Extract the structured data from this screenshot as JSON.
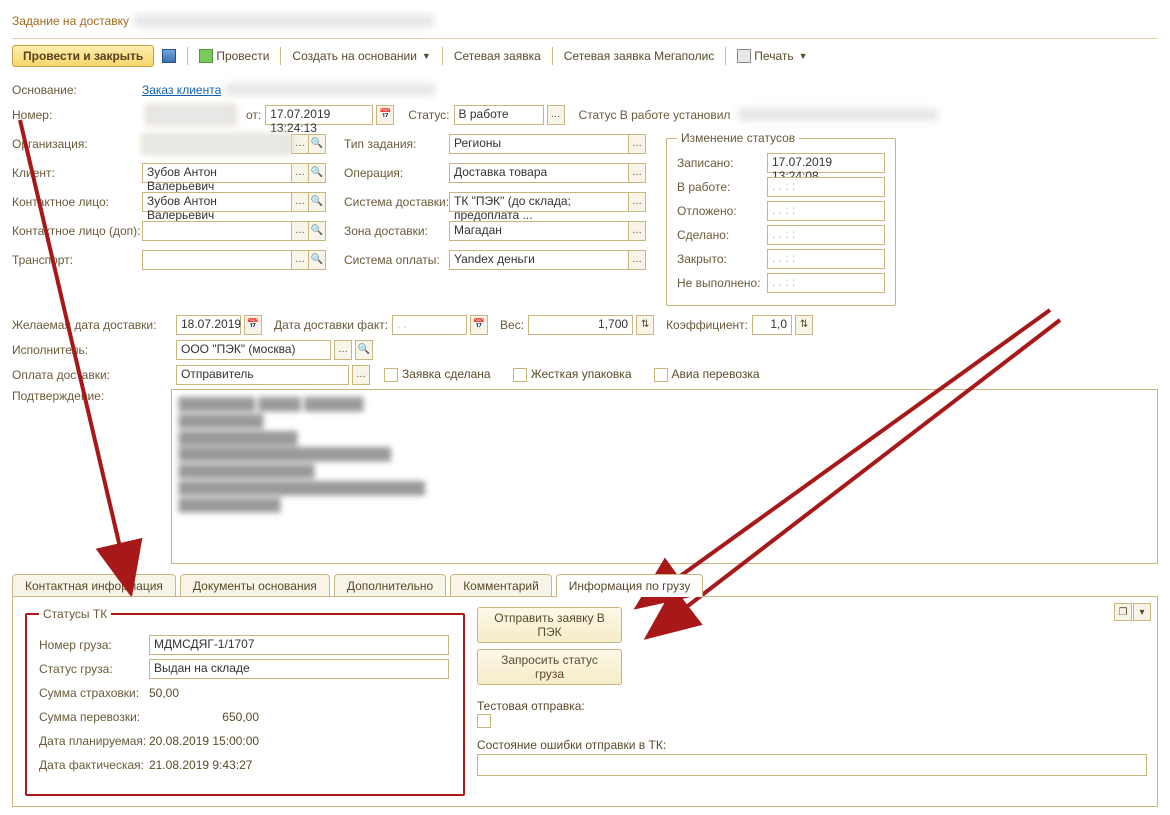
{
  "title": "Задание на доставку",
  "toolbar": {
    "post_close": "Провести и закрыть",
    "provesti": "Провести",
    "create_based": "Создать на основании",
    "net_request": "Сетевая заявка",
    "net_request_mega": "Сетевая заявка Мегаполис",
    "print": "Печать"
  },
  "labels": {
    "osnovanie": "Основание:",
    "zakaz": "Заказ клиента",
    "nomer": "Номер:",
    "ot": "от:",
    "status": "Статус:",
    "status_set_by": "Статус В работе установил",
    "org": "Организация:",
    "client": "Клиент:",
    "contact": "Контактное лицо:",
    "contact_dop": "Контактное лицо (доп):",
    "transport": "Транспорт:",
    "tip_zadaniya": "Тип задания:",
    "operation": "Операция:",
    "delivery_sys": "Система доставки:",
    "delivery_zone": "Зона доставки:",
    "pay_sys": "Система оплаты:",
    "status_change": "Изменение статусов",
    "zapisano": "Записано:",
    "v_rabote": "В работе:",
    "otlozheno": "Отложено:",
    "sdelano": "Сделано:",
    "zakryto": "Закрыто:",
    "ne_vypolneno": "Не выполнено:",
    "desired_date": "Желаемая дата доставки:",
    "fact_date": "Дата доставки факт:",
    "weight": "Вес:",
    "coef": "Коэффициент:",
    "ispolnitel": "Исполнитель:",
    "oplata": "Оплата доставки:",
    "confirm": "Подтверждение:",
    "zayavka_sdelana": "Заявка сделана",
    "zhestkaya": "Жесткая упаковка",
    "avia": "Авиа перевозка",
    "empty_date": ".  .       :  :"
  },
  "values": {
    "date_from": "17.07.2019 13:24:13",
    "status_val": "В работе",
    "client": "Зубов Антон Валерьевич",
    "contact": "Зубов Антон Валерьевич",
    "tip_zadaniya": "Регионы",
    "operation": "Доставка товара",
    "delivery_sys": "ТК \"ПЭК\" (до склада; предоплата ...",
    "delivery_zone": "Магадан",
    "pay_sys": "Yandex деньги",
    "zapisano_dt": "17.07.2019 13:24:08",
    "desired_date": "18.07.2019",
    "fact_date": ".  .",
    "weight": "1,700",
    "coef": "1,0",
    "ispolnitel": "ООО \"ПЭК\" (москва)",
    "oplata": "Отправитель"
  },
  "tabs": {
    "t0": "Контактная информация",
    "t1": "Документы основания",
    "t2": "Дополнительно",
    "t3": "Комментарий",
    "t4": "Информация по грузу"
  },
  "tk": {
    "legend": "Статусы ТК",
    "cargo_num_lbl": "Номер груза:",
    "cargo_num": "МДМСДЯГ-1/1707",
    "cargo_status_lbl": "Статус груза:",
    "cargo_status": "Выдан на складе",
    "insurance_lbl": "Сумма страховки:",
    "insurance": "50,00",
    "transport_sum_lbl": "Сумма перевозки:",
    "transport_sum": "650,00",
    "plan_date_lbl": "Дата планируемая:",
    "plan_date": "20.08.2019 15:00:00",
    "fact_date_lbl": "Дата фактическая:",
    "fact_date": "21.08.2019 9:43:27"
  },
  "cargo_buttons": {
    "send_pek": "Отправить заявку В ПЭК",
    "request_status": "Запросить статус груза",
    "test_send": "Тестовая отправка:",
    "error_state": "Состояние ошибки отправки в ТК:"
  }
}
